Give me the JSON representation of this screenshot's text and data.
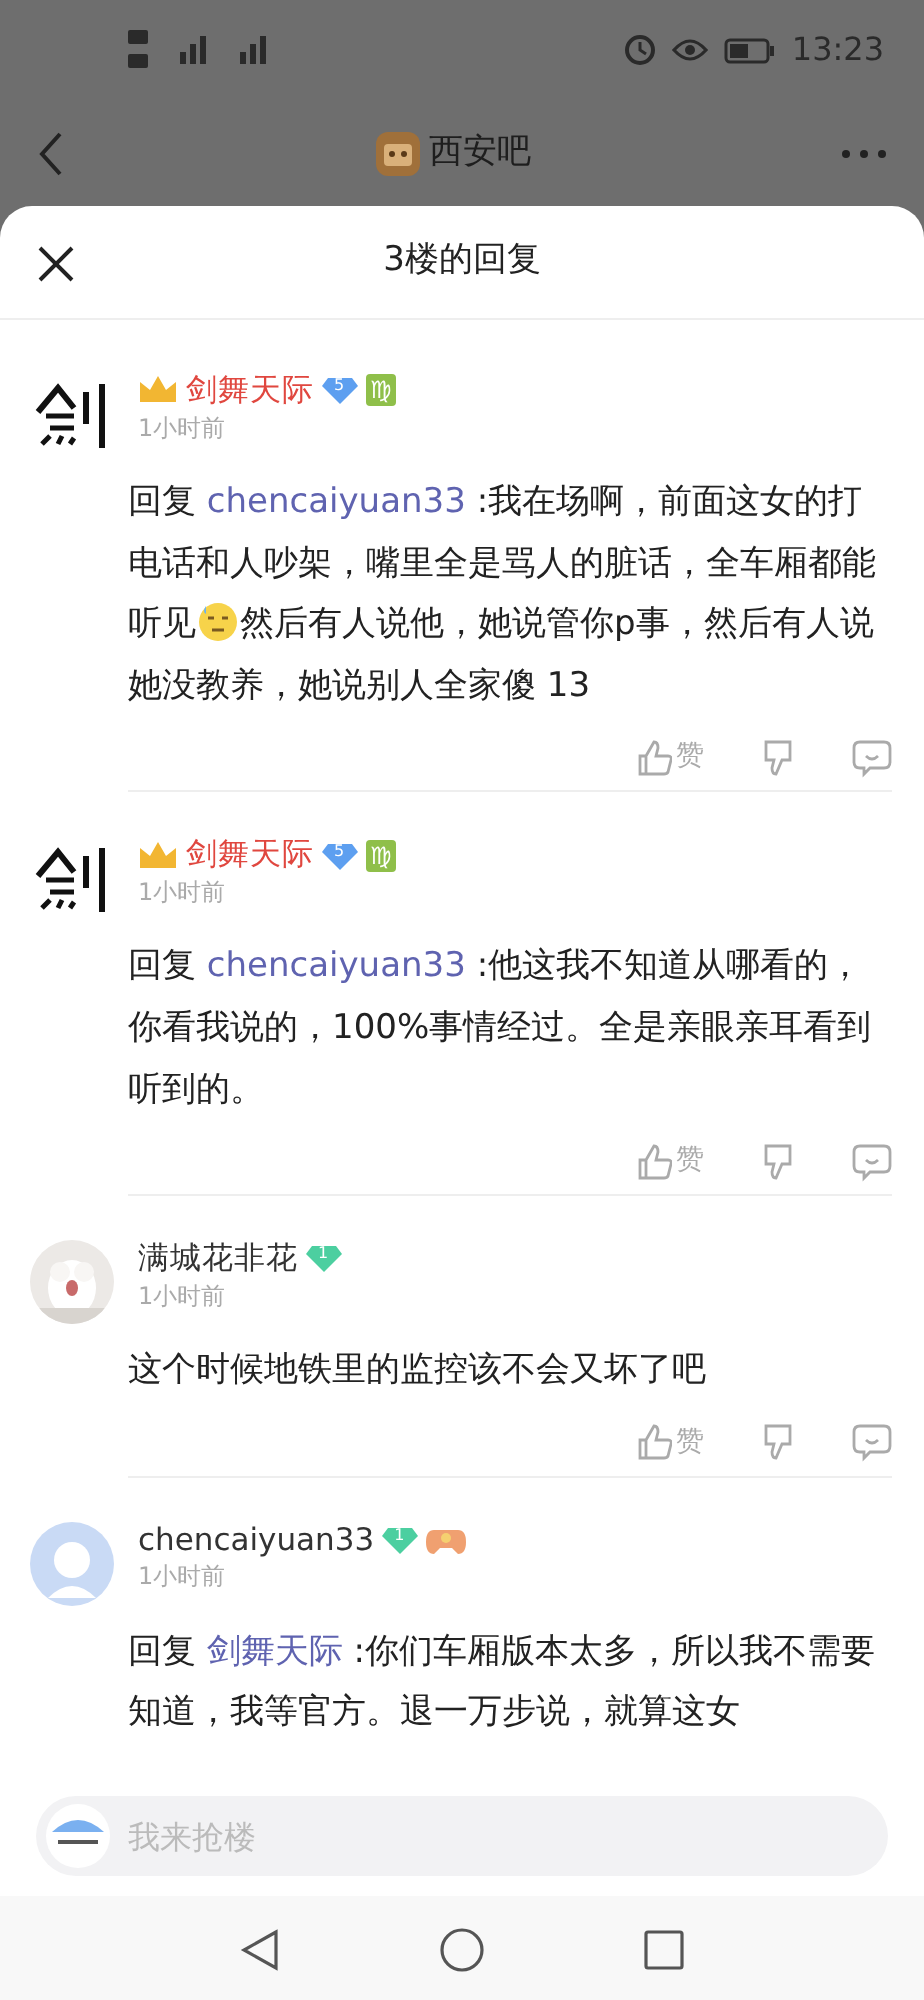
{
  "status_bar": {
    "time": "13:23"
  },
  "top_bar": {
    "title": "西安吧"
  },
  "sheet": {
    "title": "3楼的回复"
  },
  "comments": [
    {
      "avatar": {
        "kind": "picture"
      },
      "name": "剑舞天际",
      "vip": true,
      "badges": [
        {
          "kind": "diamond",
          "text": "5",
          "color": "#5d9ff0"
        },
        {
          "kind": "zodiac",
          "text": "♍"
        }
      ],
      "time": "1小时前",
      "reply_prefix": "回复",
      "reply_to": "chencaiyuan33",
      "segments": [
        {
          "kind": "text",
          "text": " :我在场啊，前面这女的打电话和人吵架，嘴里全是骂人的脏话，全车厢都能听见"
        },
        {
          "kind": "emoji"
        },
        {
          "kind": "text",
          "text": "然后有人说他，她说管你p事，然后有人说她没教养，她说别人全家傻 13"
        }
      ],
      "like_label": "赞"
    },
    {
      "avatar": {
        "kind": "picture"
      },
      "name": "剑舞天际",
      "vip": true,
      "badges": [
        {
          "kind": "diamond",
          "text": "5",
          "color": "#5d9ff0"
        },
        {
          "kind": "zodiac",
          "text": "♍"
        }
      ],
      "time": "1小时前",
      "reply_prefix": "回复",
      "reply_to": "chencaiyuan33",
      "segments": [
        {
          "kind": "text",
          "text": " :他这我不知道从哪看的，你看我说的，100%事情经过。全是亲眼亲耳看到听到的。"
        }
      ],
      "like_label": "赞"
    },
    {
      "avatar": {
        "kind": "picture"
      },
      "name": "满城花非花",
      "vip": false,
      "badges": [
        {
          "kind": "diamond",
          "text": "1",
          "color": "#4ccfa0"
        }
      ],
      "time": "1小时前",
      "segments": [
        {
          "kind": "text",
          "text": "这个时候地铁里的监控该不会又坏了吧"
        }
      ],
      "like_label": "赞"
    },
    {
      "avatar": {
        "kind": "default"
      },
      "name": "chencaiyuan33",
      "vip": false,
      "badges": [
        {
          "kind": "diamond",
          "text": "1",
          "color": "#4ccfa0"
        },
        {
          "kind": "game"
        }
      ],
      "time": "1小时前",
      "reply_prefix": "回复",
      "reply_to": "剑舞天际",
      "segments": [
        {
          "kind": "text",
          "text": " :你们车厢版本太多，所以我不需要知道，我等官方。退一万步说，就算这女"
        }
      ]
    }
  ],
  "input": {
    "placeholder": "我来抢楼"
  }
}
